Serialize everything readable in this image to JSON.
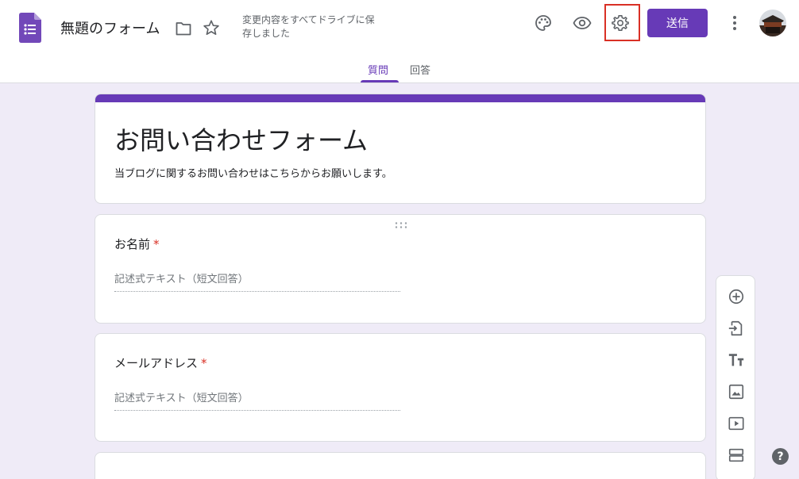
{
  "header": {
    "doc_title": "無題のフォーム",
    "save_status": "変更内容をすべてドライブに保存しました",
    "send_label": "送信"
  },
  "tabs": [
    {
      "label": "質問",
      "active": true
    },
    {
      "label": "回答",
      "active": false
    }
  ],
  "form": {
    "title": "お問い合わせフォーム",
    "description": "当ブログに関するお問い合わせはこちらからお願いします。"
  },
  "questions": [
    {
      "title": "お名前",
      "required_mark": "*",
      "answer_placeholder": "記述式テキスト（短文回答）"
    },
    {
      "title": "メールアドレス",
      "required_mark": "*",
      "answer_placeholder": "記述式テキスト（短文回答）"
    }
  ],
  "toolbar": {
    "title_text_glyph": "TT"
  },
  "help": {
    "label": "?"
  },
  "colors": {
    "accent": "#673ab7",
    "background": "#efebf7",
    "required": "#d93025",
    "highlight_box": "#d93025"
  },
  "icons": {
    "header": [
      "forms-logo-icon",
      "folder-icon",
      "star-icon",
      "palette-icon",
      "preview-eye-icon",
      "settings-gear-icon",
      "more-vert-icon"
    ],
    "toolbar": [
      "add-circle-icon",
      "import-questions-icon",
      "title-text-icon",
      "image-icon",
      "video-icon",
      "section-icon"
    ]
  }
}
